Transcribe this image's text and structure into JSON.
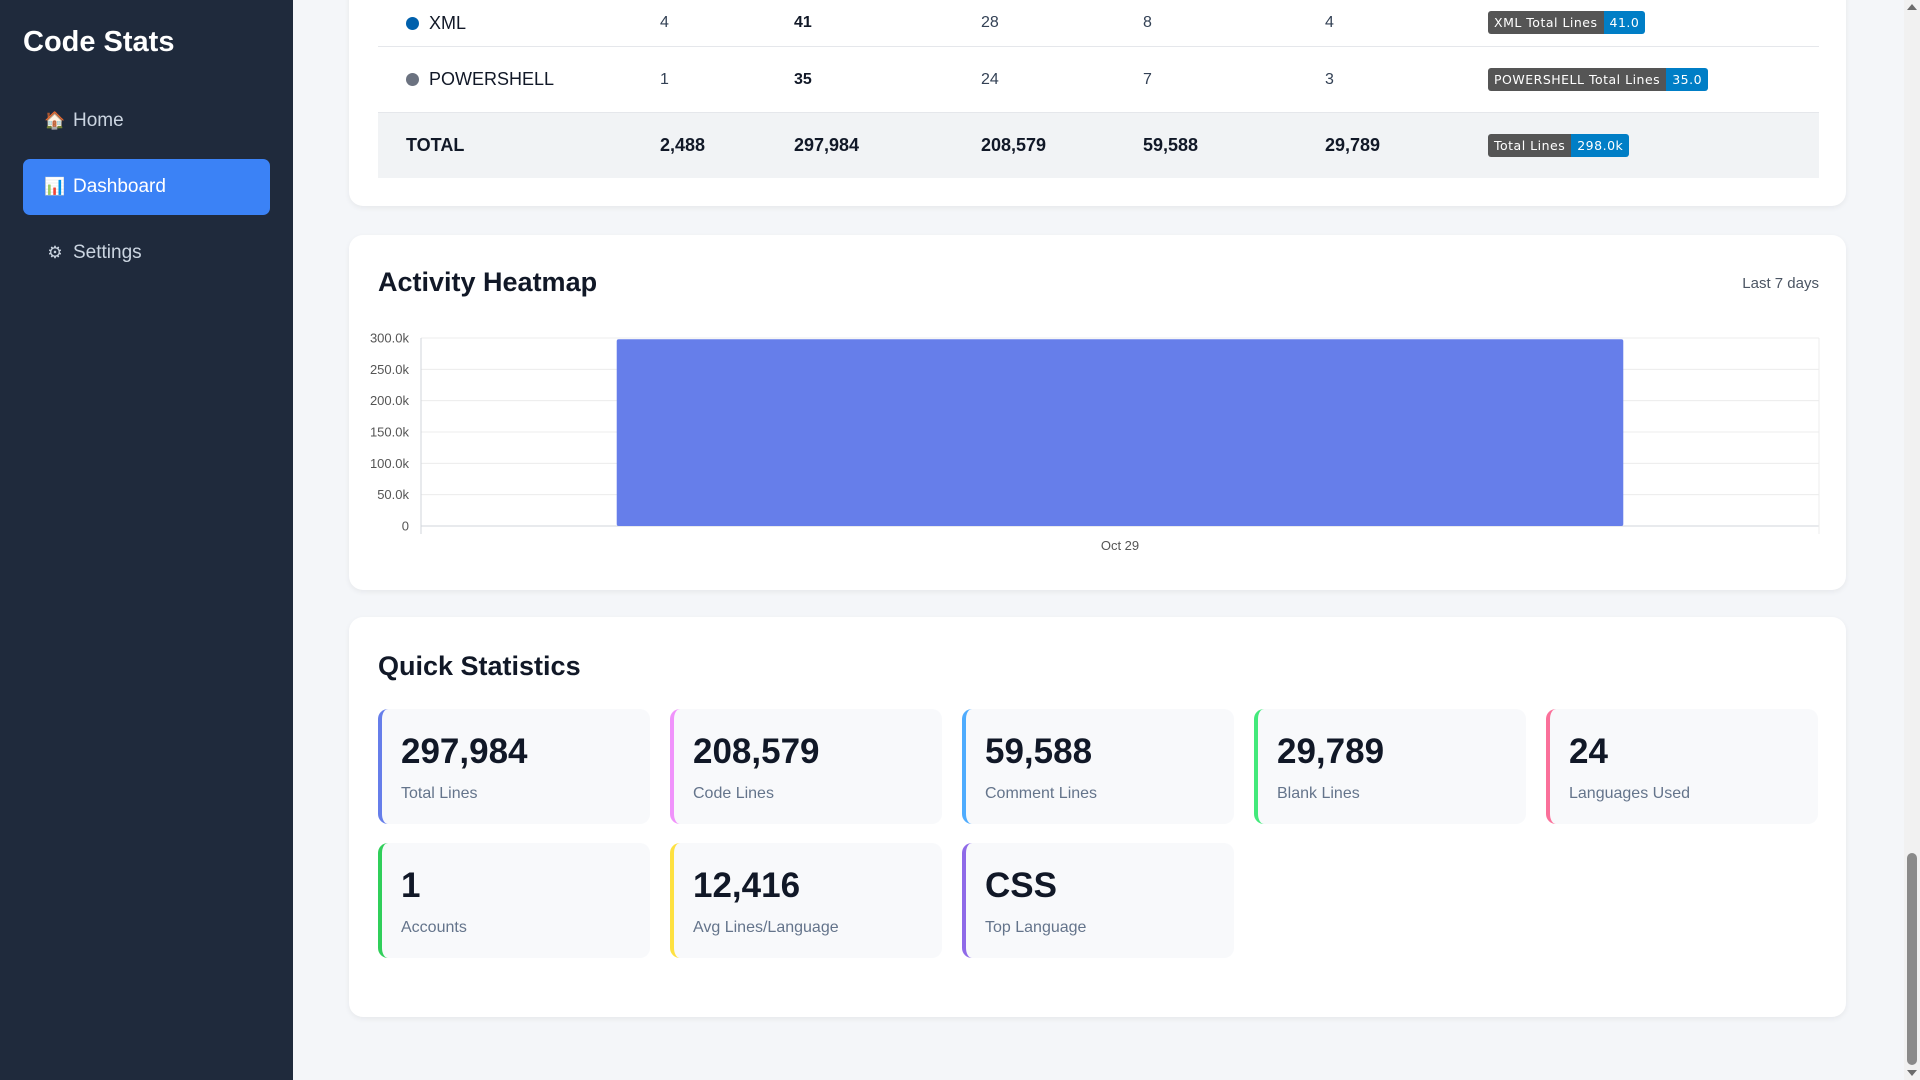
{
  "sidebar": {
    "brand": "Code Stats",
    "items": [
      {
        "label": "Home",
        "icon": "house-icon",
        "glyph": "🏠",
        "active": false
      },
      {
        "label": "Dashboard",
        "icon": "bar-chart-icon",
        "glyph": "📊",
        "active": true
      },
      {
        "label": "Settings",
        "icon": "gear-icon",
        "glyph": "⚙",
        "active": false
      }
    ]
  },
  "table": {
    "rows": [
      {
        "lang": "XML",
        "dot_color": "#0060ac",
        "files": "4",
        "total": "41",
        "code": "28",
        "comment": "8",
        "blank": "4",
        "badge_label": "XML Total Lines",
        "badge_value": "41.0"
      },
      {
        "lang": "POWERSHELL",
        "dot_color": "#6b7280",
        "files": "1",
        "total": "35",
        "code": "24",
        "comment": "7",
        "blank": "3",
        "badge_label": "POWERSHELL Total Lines",
        "badge_value": "35.0"
      }
    ],
    "total": {
      "lang": "TOTAL",
      "files": "2,488",
      "total": "297,984",
      "code": "208,579",
      "comment": "59,588",
      "blank": "29,789",
      "badge_label": "Total Lines",
      "badge_value": "298.0k"
    }
  },
  "heatmap": {
    "title": "Activity Heatmap",
    "range_label": "Last 7 days"
  },
  "chart_data": {
    "type": "bar",
    "categories": [
      "Oct 29"
    ],
    "values": [
      297984
    ],
    "ylim": [
      0,
      300000
    ],
    "yticks": [
      0,
      50000,
      100000,
      150000,
      200000,
      250000,
      300000
    ],
    "ytick_labels": [
      "0",
      "50.0k",
      "100.0k",
      "150.0k",
      "200.0k",
      "250.0k",
      "300.0k"
    ],
    "bar_color": "#667eea",
    "grid": true
  },
  "stats": {
    "title": "Quick Statistics",
    "items": [
      {
        "value": "297,984",
        "label": "Total Lines",
        "color": "#667eea"
      },
      {
        "value": "208,579",
        "label": "Code Lines",
        "color": "#f093fb"
      },
      {
        "value": "59,588",
        "label": "Comment Lines",
        "color": "#4facfe"
      },
      {
        "value": "29,789",
        "label": "Blank Lines",
        "color": "#43e97b"
      },
      {
        "value": "24",
        "label": "Languages Used",
        "color": "#fa709a"
      },
      {
        "value": "1",
        "label": "Accounts",
        "color": "#30cf5a"
      },
      {
        "value": "12,416",
        "label": "Avg Lines/Language",
        "color": "#fee140"
      },
      {
        "value": "CSS",
        "label": "Top Language",
        "color": "#8f6ae8"
      }
    ]
  }
}
